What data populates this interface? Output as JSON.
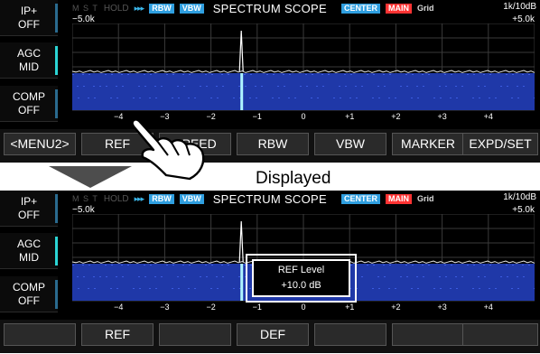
{
  "side_panel": [
    {
      "label": "IP+",
      "value": "OFF",
      "active": false
    },
    {
      "label": "AGC",
      "value": "MID",
      "active": true
    },
    {
      "label": "COMP",
      "value": "OFF",
      "active": false
    }
  ],
  "scope": {
    "header_dim": "M  S  T",
    "hold": "HOLD",
    "arrows": "▸▸▸",
    "rbw": "RBW",
    "vbw": "VBW",
    "title": "SPECTRUM SCOPE",
    "center": "CENTER",
    "main": "MAIN",
    "grid": "Grid",
    "scale": "1k/10dB",
    "span_left": "−5.0k",
    "span_right": "+5.0k",
    "freq_ticks": [
      "−4",
      "−3",
      "−2",
      "−1",
      "0",
      "+1",
      "+2",
      "+3",
      "+4"
    ],
    "colors": {
      "waterfall": "#1f38a8",
      "signal": "#aef4ff",
      "accent": "#2bd4d4"
    }
  },
  "top_menu": [
    "<MENU2>",
    "REF",
    "SPEED",
    "RBW",
    "VBW",
    "MARKER",
    "EXPD/SET"
  ],
  "bottom_menu": [
    "",
    "REF",
    "",
    "DEF",
    "",
    "",
    ""
  ],
  "annotation": {
    "displayed": "Displayed"
  },
  "popup": {
    "line1": "REF Level",
    "line2": "+10.0 dB"
  }
}
